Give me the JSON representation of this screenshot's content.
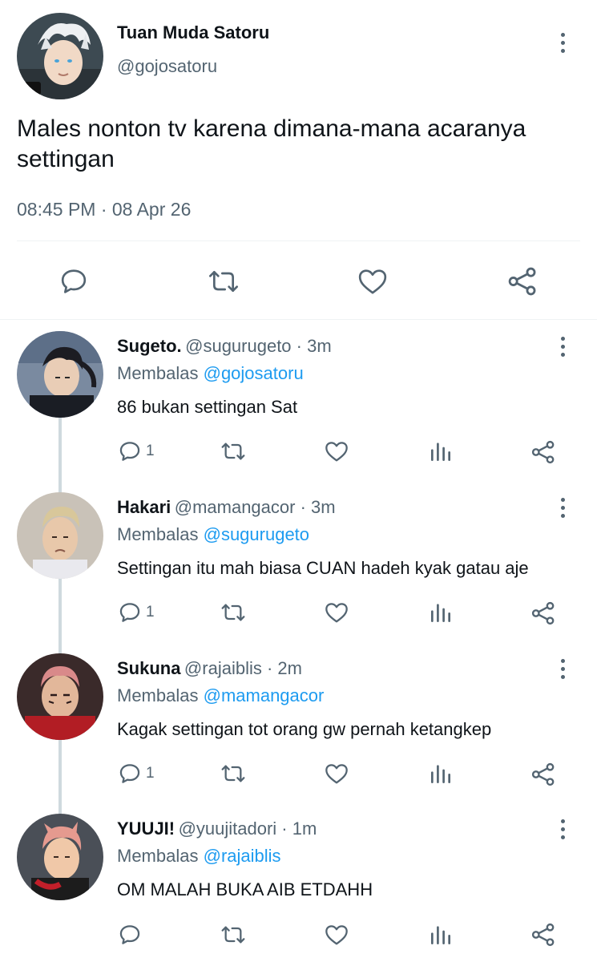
{
  "main_tweet": {
    "display_name": "Tuan Muda Satoru",
    "handle": "@gojosatoru",
    "text_line1": "Males nonton tv karena dimana-mana acaranya",
    "text_line2": "settingan",
    "timestamp": "08:45 PM · 08 Apr 26",
    "actions": [
      "reply-icon",
      "retweet-icon",
      "like-icon",
      "share-icon"
    ]
  },
  "replies": [
    {
      "display_name": "Sugeto.",
      "meta": "@sugurugeto · 3m",
      "replying_label": "Membalas",
      "replying_to": "@gojosatoru",
      "text": "86 bukan settingan Sat",
      "reply_count": "1"
    },
    {
      "display_name": "Hakari",
      "meta": "@mamangacor · 3m",
      "replying_label": "Membalas",
      "replying_to": "@sugurugeto",
      "text": "Settingan itu mah biasa CUAN hadeh kyak gatau aje",
      "reply_count": "1"
    },
    {
      "display_name": "Sukuna",
      "meta": "@rajaiblis · 2m",
      "replying_label": "Membalas",
      "replying_to": "@mamangacor",
      "text": "Kagak settingan tot orang gw pernah ketangkep",
      "reply_count": "1"
    },
    {
      "display_name": "YUUJI!",
      "meta": "@yuujitadori · 1m",
      "replying_label": "Membalas",
      "replying_to": "@rajaiblis",
      "text": "OM MALAH BUKA AIB ETDAHH",
      "reply_count": ""
    }
  ],
  "colors": {
    "text": "#0f1419",
    "secondary": "#536471",
    "link": "#1d9bf0",
    "divider": "#eff3f4",
    "thread_line": "#cfd9de"
  }
}
